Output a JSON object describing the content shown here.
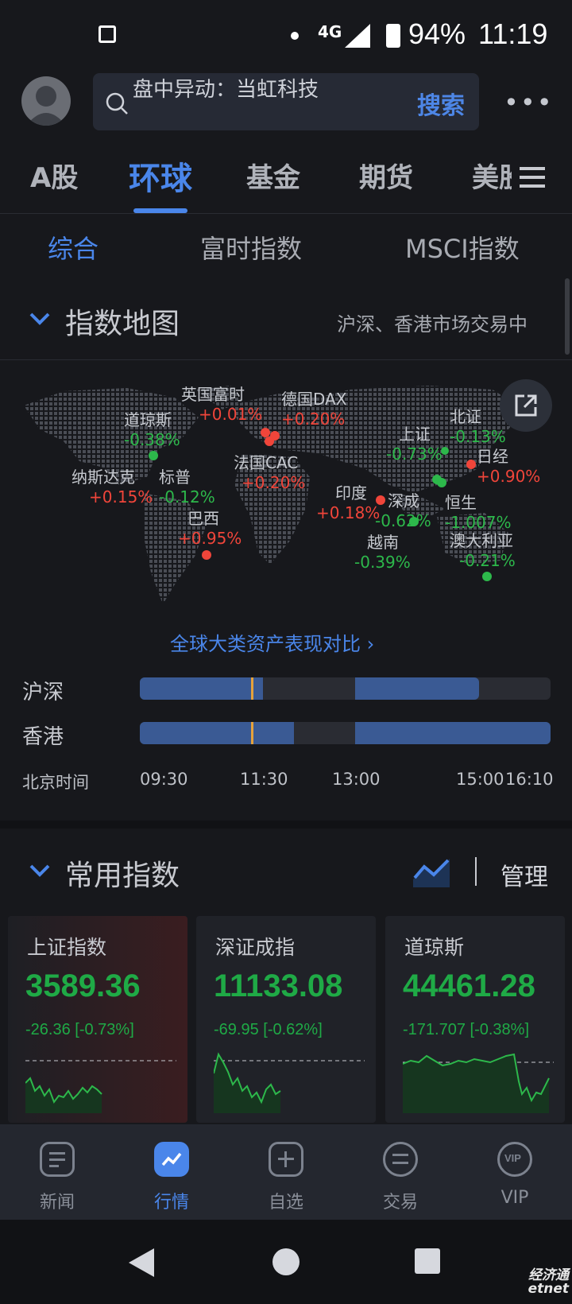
{
  "status": {
    "signal": "4G",
    "battery": "94%",
    "time": "11:19"
  },
  "header": {
    "search_placeholder": "盘中异动：当虹科技",
    "search_button": "搜索",
    "more_icon": "ellipsis-icon"
  },
  "main_tabs": [
    {
      "label": "A股"
    },
    {
      "label": "环球"
    },
    {
      "label": "基金"
    },
    {
      "label": "期货"
    },
    {
      "label": "美股"
    }
  ],
  "sub_tabs": [
    {
      "label": "综合"
    },
    {
      "label": "富时指数"
    },
    {
      "label": "MSCI指数"
    }
  ],
  "map_section": {
    "title": "指数地图",
    "note": "沪深、香港市场交易中",
    "markers": [
      {
        "name": "英国富时",
        "change": "+0.01%",
        "dir": "up"
      },
      {
        "name": "德国DAX",
        "change": "+0.20%",
        "dir": "up"
      },
      {
        "name": "道琼斯",
        "change": "-0.38%",
        "dir": "dn"
      },
      {
        "name": "北证",
        "change": "-0.13%",
        "dir": "dn"
      },
      {
        "name": "上证",
        "change": "-0.73%",
        "dir": "dn"
      },
      {
        "name": "日经",
        "change": "+0.90%",
        "dir": "up"
      },
      {
        "name": "法国CAC",
        "change": "+0.20%",
        "dir": "up"
      },
      {
        "name": "纳斯达克",
        "change": "+0.15%",
        "dir": "up"
      },
      {
        "name": "标普",
        "change": "-0.12%",
        "dir": "dn"
      },
      {
        "name": "印度",
        "change": "+0.18%",
        "dir": "up"
      },
      {
        "name": "深成",
        "change": "-0.62%",
        "dir": "dn"
      },
      {
        "name": "恒生",
        "change": "-1.007%",
        "dir": "dn"
      },
      {
        "name": "巴西",
        "change": "+0.95%",
        "dir": "up"
      },
      {
        "name": "越南",
        "change": "-0.39%",
        "dir": "dn"
      },
      {
        "name": "澳大利亚",
        "change": "-0.21%",
        "dir": "dn"
      }
    ],
    "compare_link": "全球大类资产表现对比 ›",
    "share_icon": "share-icon"
  },
  "timeline": {
    "rows": [
      {
        "label": "沪深"
      },
      {
        "label": "香港"
      }
    ],
    "tick_caption": "北京时间",
    "ticks": [
      "09:30",
      "11:30",
      "13:00",
      "15:00",
      "16:10"
    ]
  },
  "indices_section": {
    "title": "常用指数",
    "manage": "管理",
    "cards": [
      {
        "name": "上证指数",
        "value": "3589.36",
        "change": "-26.36 [-0.73%]"
      },
      {
        "name": "深证成指",
        "value": "11133.08",
        "change": "-69.95 [-0.62%]"
      },
      {
        "name": "道琼斯",
        "value": "44461.28",
        "change": "-171.707 [-0.38%]"
      }
    ]
  },
  "bottom_nav": [
    {
      "label": "新闻",
      "icon": "news-icon"
    },
    {
      "label": "行情",
      "icon": "market-icon"
    },
    {
      "label": "自选",
      "icon": "plus-icon"
    },
    {
      "label": "交易",
      "icon": "trade-icon"
    },
    {
      "label": "VIP",
      "icon": "vip-icon"
    }
  ],
  "watermark": "经济通 etnet",
  "colors": {
    "accent": "#4a86ea",
    "up": "#f0453a",
    "down": "#2db84b",
    "background": "#17181c"
  }
}
